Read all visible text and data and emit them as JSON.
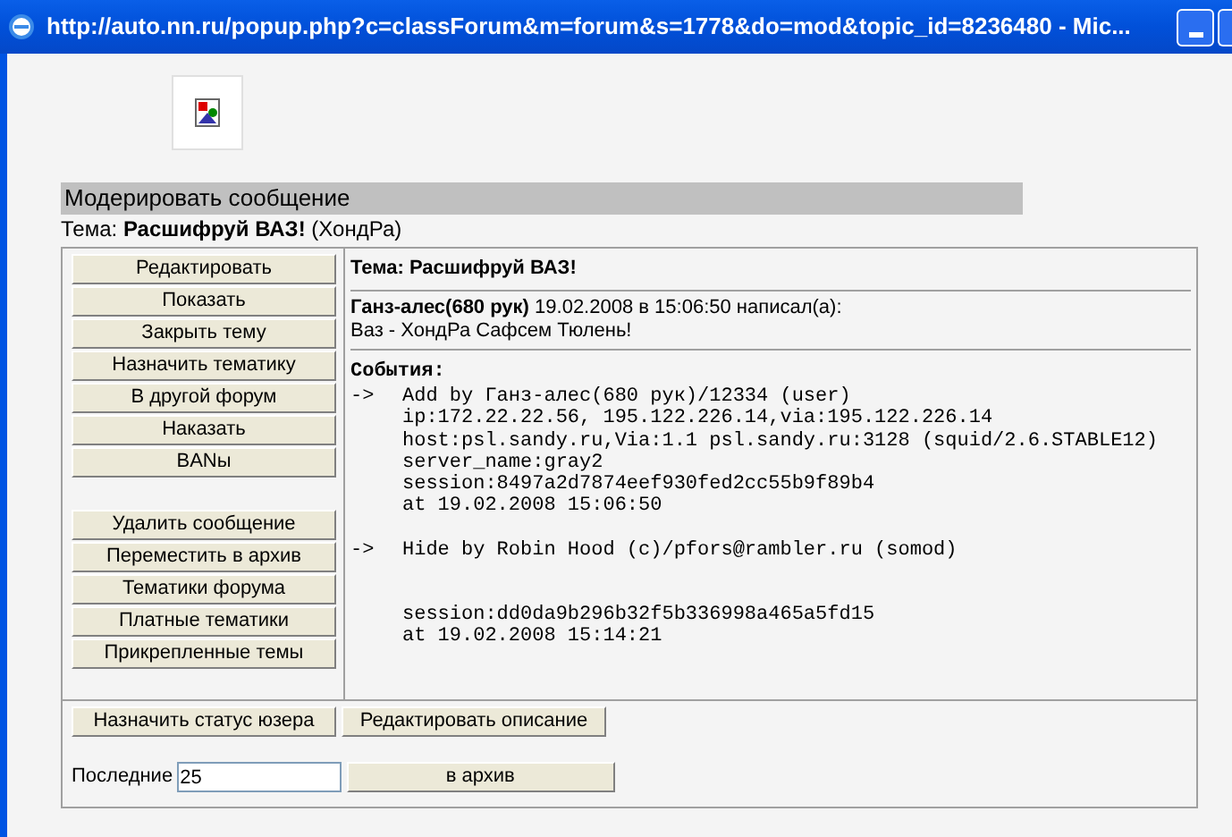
{
  "window": {
    "title": "http://auto.nn.ru/popup.php?c=classForum&m=forum&s=1778&do=mod&topic_id=8236480 - Mic..."
  },
  "header": {
    "title": "Модерировать сообщение",
    "topic_label": "Тема:",
    "topic_name": "Расшифруй ВАЗ!",
    "topic_author": "(ХондРа)"
  },
  "actions": {
    "group_1": [
      "Редактировать",
      "Показать",
      "Закрыть тему",
      "Назначить тематику",
      "В другой форум",
      "Наказать",
      "BANы"
    ],
    "group_2": [
      "Удалить сообщение",
      "Переместить в архив",
      "Тематики форума",
      "Платные тематики",
      "Прикрепленные темы"
    ]
  },
  "message": {
    "topic": "Тема: Расшифруй ВАЗ!",
    "author": "Ганз-алес(680 рук)",
    "meta": "19.02.2008 в 15:06:50 написал(а):",
    "body": "Ваз - ХондРа Сафсем Тюлень!"
  },
  "events": {
    "title": "События:",
    "items": [
      {
        "arrow": "->",
        "lines": [
          "Add by Ганз-алес(680 рук)/12334 (user)",
          "ip:172.22.22.56, 195.122.226.14,via:195.122.226.14",
          "host:psl.sandy.ru,Via:1.1 psl.sandy.ru:3128 (squid/2.6.STABLE12)",
          "server_name:gray2",
          "session:8497a2d7874eef930fed2cc55b9f89b4",
          "at 19.02.2008 15:06:50"
        ]
      },
      {
        "arrow": "->",
        "lines": [
          "Hide by Robin Hood (c)/pfors@rambler.ru (somod)"
        ]
      },
      {
        "lines": [
          "session:dd0da9b296b32f5b336998a465a5fd15",
          "at 19.02.2008 15:14:21"
        ]
      }
    ]
  },
  "footer": {
    "buttons": [
      "Назначить статус юзера",
      "Редактировать описание"
    ],
    "last_label": "Последние",
    "last_value": "25",
    "archive_button": "в архив"
  }
}
